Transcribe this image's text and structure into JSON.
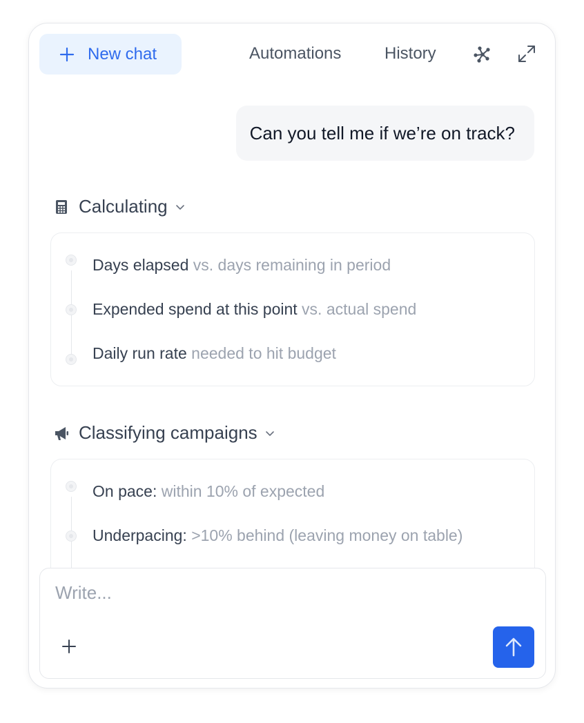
{
  "header": {
    "new_chat_label": "New chat",
    "links": [
      "Automations",
      "History"
    ],
    "icons": [
      "plus-icon",
      "network-icon",
      "expand-icon"
    ]
  },
  "conversation": {
    "user_message": "Can you tell me if we’re on track?"
  },
  "sections": [
    {
      "title": "Calculating",
      "icon": "calculator-icon",
      "steps": [
        {
          "strong": "Days elapsed",
          "muted": " vs. days remaining in period"
        },
        {
          "strong": "Expended spend at this point",
          "muted": " vs. actual spend"
        },
        {
          "strong": "Daily run rate",
          "muted": " needed to hit budget"
        }
      ]
    },
    {
      "title": "Classifying campaigns",
      "icon": "megaphone-icon",
      "steps": [
        {
          "strong": "On pace:",
          "muted": " within 10% of expected"
        },
        {
          "strong": "Underpacing:",
          "muted": " >10% behind (leaving money on table)"
        }
      ]
    }
  ],
  "composer": {
    "placeholder": "Write..."
  },
  "colors": {
    "accent": "#2563eb",
    "new_chat_bg": "#eaf3fe",
    "new_chat_text": "#2f6bed",
    "muted_text": "#9ca3af"
  }
}
